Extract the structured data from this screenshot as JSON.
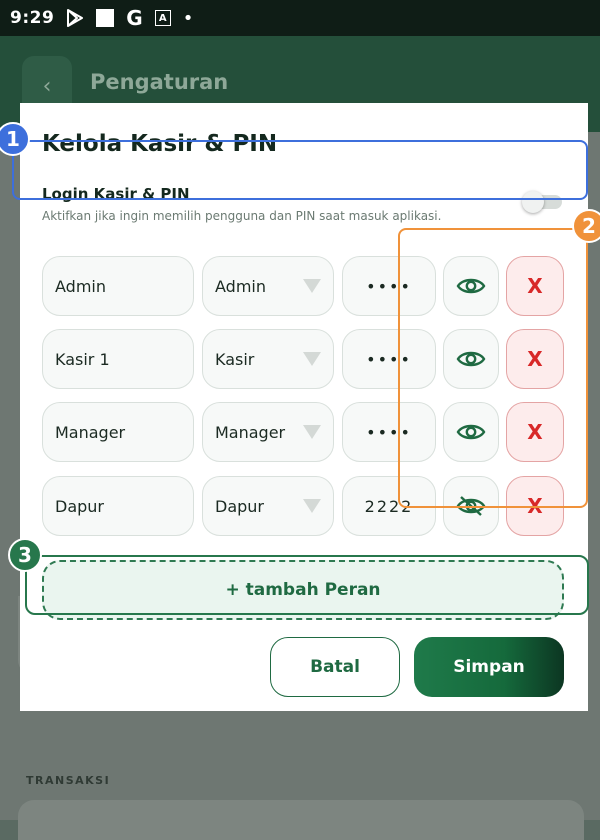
{
  "status_bar": {
    "time": "9:29",
    "icons": [
      "play-store-icon",
      "square-notification-icon",
      "google-icon",
      "a-box-icon",
      "dot-icon"
    ],
    "g_glyph": "G",
    "a_glyph": "A",
    "dot_glyph": "•"
  },
  "background": {
    "back_glyph": "‹",
    "header_title": "Pengaturan",
    "section_label": "TRANSAKSI"
  },
  "modal": {
    "title": "Kelola Kasir & PIN",
    "login_toggle": {
      "label": "Login Kasir & PIN",
      "description": "Aktifkan jika ingin memilih pengguna dan PIN saat masuk aplikasi.",
      "enabled": false
    },
    "users": [
      {
        "name": "Admin",
        "role": "Admin",
        "pin": "••••",
        "pin_visible": false
      },
      {
        "name": "Kasir 1",
        "role": "Kasir",
        "pin": "••••",
        "pin_visible": false
      },
      {
        "name": "Manager",
        "role": "Manager",
        "pin": "••••",
        "pin_visible": false
      },
      {
        "name": "Dapur",
        "role": "Dapur",
        "pin": "2222",
        "pin_visible": true
      }
    ],
    "delete_label": "X",
    "add_role_label": "+ tambah Peran",
    "cancel_label": "Batal",
    "save_label": "Simpan"
  },
  "annotations": [
    "1",
    "2",
    "3"
  ],
  "colors": {
    "primary_green": "#1f6a42",
    "delete_red": "#d82828",
    "annotation_blue": "#3d6fdc",
    "annotation_orange": "#f0923a",
    "annotation_green": "#27774c"
  }
}
